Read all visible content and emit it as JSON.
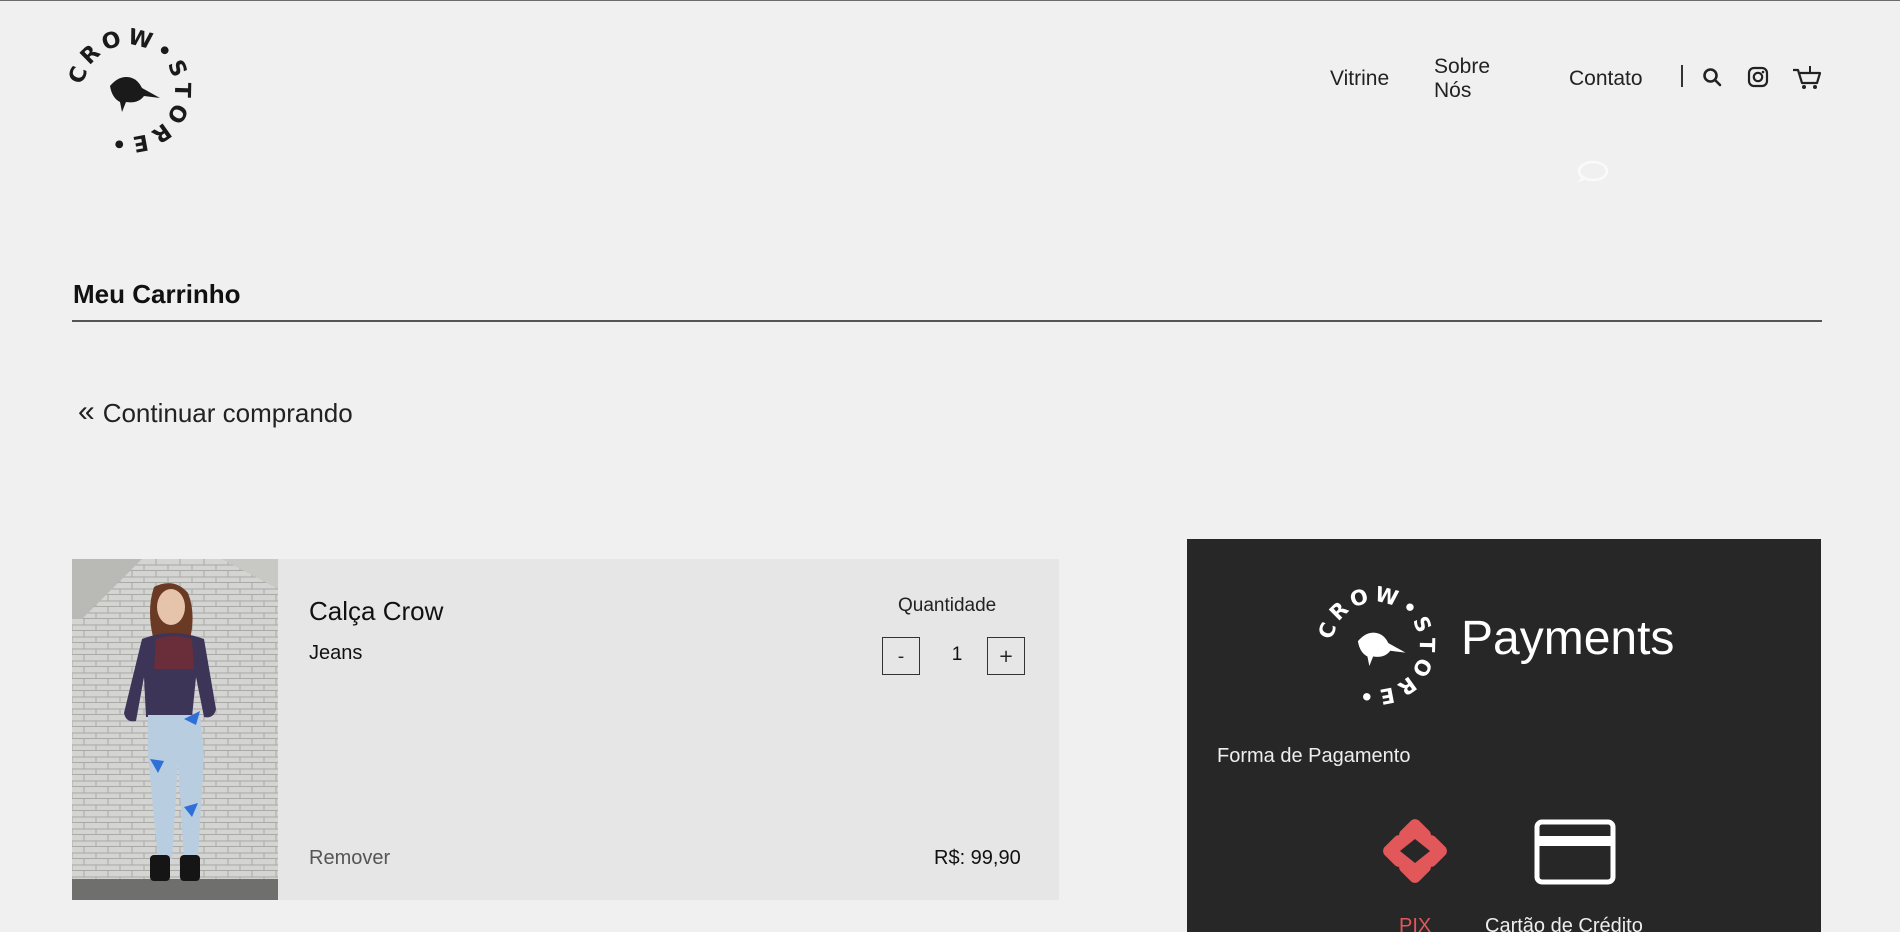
{
  "brand": {
    "logo_top": "STORE",
    "logo_bottom": "CROW"
  },
  "nav": {
    "links": [
      "Vitrine",
      "Sobre Nós",
      "Contato"
    ],
    "icons": [
      "search-icon",
      "instagram-icon",
      "cart-icon"
    ],
    "floating_icon": "whatsapp-icon"
  },
  "page": {
    "title": "Meu Carrinho",
    "continue_label": "Continuar comprando"
  },
  "cart": {
    "items": [
      {
        "name": "Calça Crow",
        "variant": "Jeans",
        "quantity_label": "Quantidade",
        "quantity": "1",
        "minus_label": "-",
        "plus_label": "+",
        "remove_label": "Remover",
        "price": "R$: 99,90"
      }
    ]
  },
  "payments": {
    "title": "Payments",
    "method_label": "Forma de Pagamento",
    "methods": [
      "PIX",
      "Cartão de Crédito"
    ],
    "selected": "PIX"
  },
  "colors": {
    "background": "#f0f0f0",
    "panel": "#272727",
    "accent": "#e2575a",
    "card_bg": "#e6e6e6"
  }
}
